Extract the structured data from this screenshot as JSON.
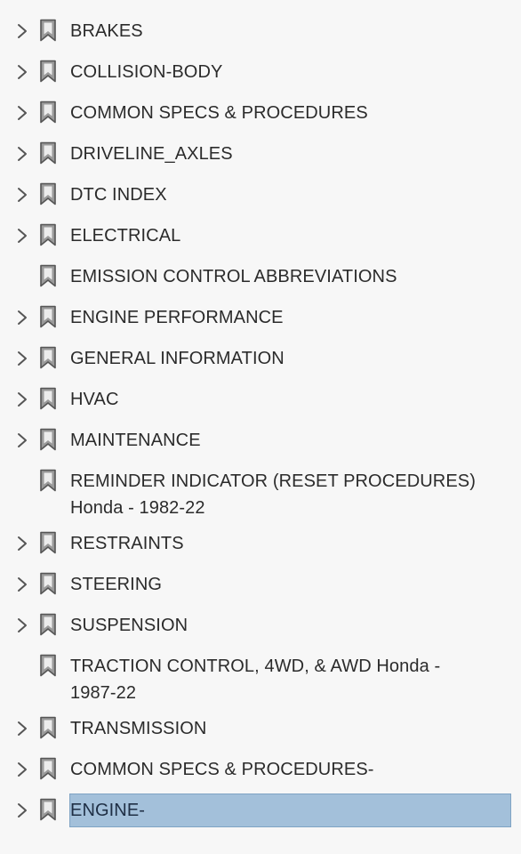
{
  "bookmarks": {
    "items": [
      {
        "label": "BRAKES",
        "expandable": true,
        "selected": false
      },
      {
        "label": "COLLISION-BODY",
        "expandable": true,
        "selected": false
      },
      {
        "label": "COMMON SPECS & PROCEDURES",
        "expandable": true,
        "selected": false
      },
      {
        "label": "DRIVELINE_AXLES",
        "expandable": true,
        "selected": false
      },
      {
        "label": "DTC INDEX",
        "expandable": true,
        "selected": false
      },
      {
        "label": "ELECTRICAL",
        "expandable": true,
        "selected": false
      },
      {
        "label": "EMISSION CONTROL ABBREVIATIONS",
        "expandable": false,
        "selected": false
      },
      {
        "label": "ENGINE PERFORMANCE",
        "expandable": true,
        "selected": false
      },
      {
        "label": "GENERAL INFORMATION",
        "expandable": true,
        "selected": false
      },
      {
        "label": "HVAC",
        "expandable": true,
        "selected": false
      },
      {
        "label": "MAINTENANCE",
        "expandable": true,
        "selected": false
      },
      {
        "label": "REMINDER INDICATOR (RESET PROCEDURES)\nHonda - 1982-22",
        "expandable": false,
        "selected": false
      },
      {
        "label": "RESTRAINTS",
        "expandable": true,
        "selected": false
      },
      {
        "label": "STEERING",
        "expandable": true,
        "selected": false
      },
      {
        "label": "SUSPENSION",
        "expandable": true,
        "selected": false
      },
      {
        "label": "TRACTION CONTROL, 4WD, & AWD Honda -\n1987-22",
        "expandable": false,
        "selected": false
      },
      {
        "label": "TRANSMISSION",
        "expandable": true,
        "selected": false
      },
      {
        "label": "COMMON SPECS & PROCEDURES-",
        "expandable": true,
        "selected": false
      },
      {
        "label": "ENGINE-",
        "expandable": true,
        "selected": true
      }
    ]
  },
  "icons": {
    "expand": "chevron-right-icon",
    "bookmark": "bookmark-icon"
  },
  "colors": {
    "background": "#f7f7f7",
    "text": "#2b2b2b",
    "icon": "#555555",
    "icon_fill": "#9a9a9a",
    "selection": "#a3c0da"
  }
}
